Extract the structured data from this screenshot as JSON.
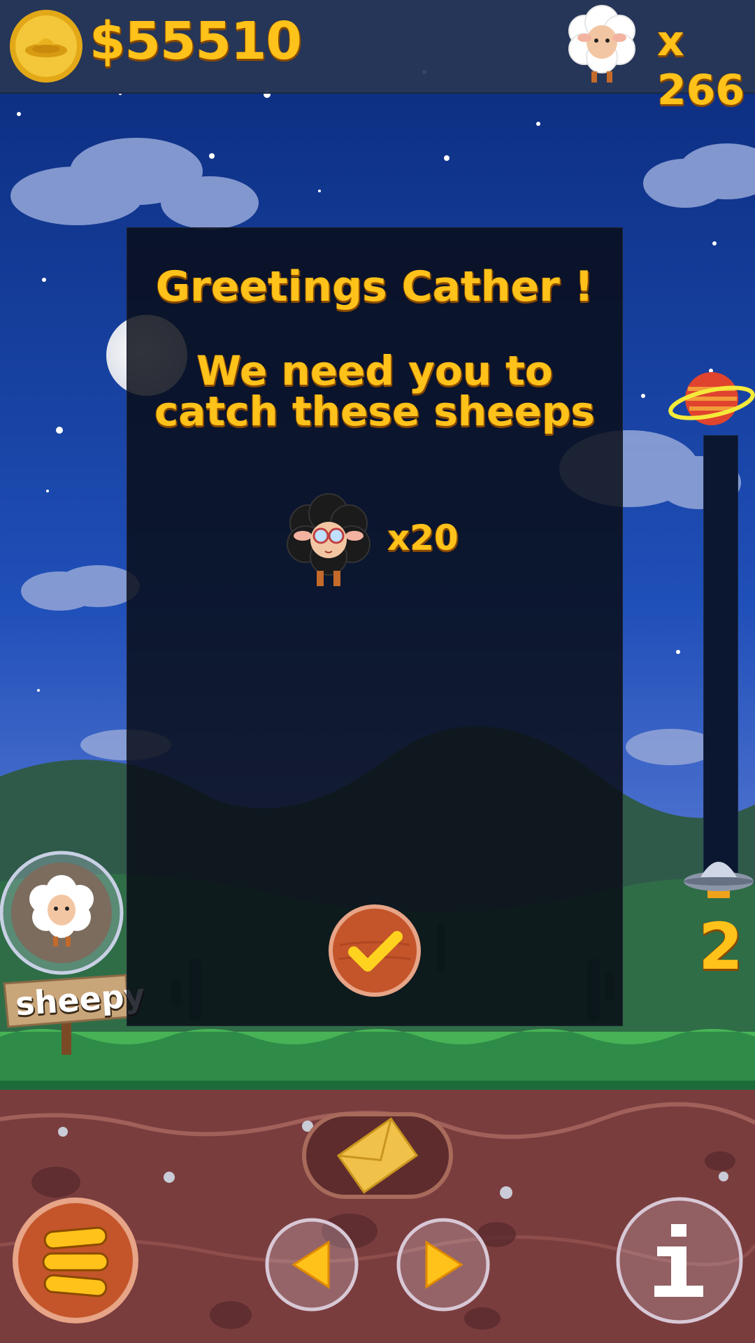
{
  "hud": {
    "money": "$55510",
    "sheep_count": "x 266"
  },
  "dialog": {
    "title": "Greetings Cather  !",
    "message_line1": "We need you to",
    "message_line2": "catch these sheeps",
    "target_count": "x20"
  },
  "sidebar": {
    "sign_label": "sheepy"
  },
  "level": {
    "number": "2"
  },
  "icons": {
    "coin": "ufo-coin-icon",
    "sheep": "white-sheep-icon",
    "target": "black-sheep-glasses-icon",
    "confirm": "checkmark-icon",
    "menu": "menu-icon",
    "mail": "envelope-icon",
    "prev": "arrow-left-icon",
    "next": "arrow-right-icon",
    "info": "info-icon"
  },
  "colors": {
    "text_gold": "#ffc21a",
    "wood": "#c4552a",
    "grass": "#2e8c48",
    "soil": "#7a3d3e",
    "sky_top": "#0a2a7a"
  }
}
